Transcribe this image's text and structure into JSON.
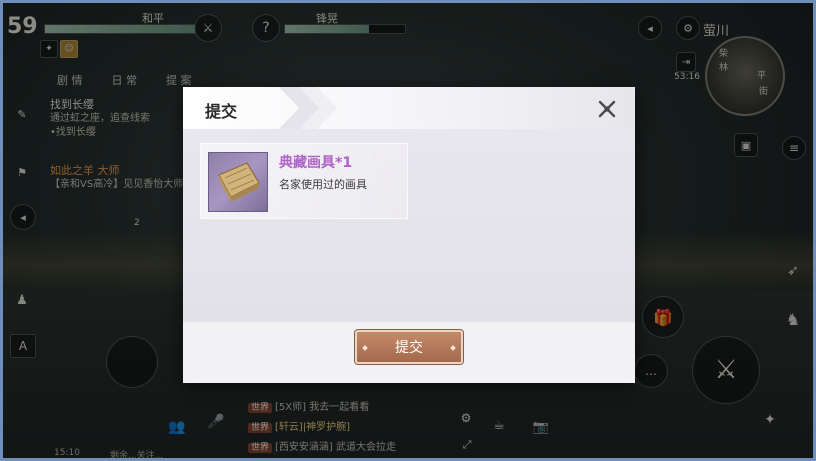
{
  "hud": {
    "level": "59",
    "team_left_name": "和平",
    "team_right_name": "锋晃",
    "right_player_name": "萤川",
    "clock": "53:16",
    "tabs": [
      "剧 情",
      "日 常",
      "提 案"
    ],
    "quest1_title": "找到长缨",
    "quest1_desc": "通过虹之座，追查线索",
    "quest1_sub": "•找到长缨",
    "quest2_title": "如此之羊 大师",
    "quest2_desc": "【亲和VS高冷】见见香怡大师",
    "quest_count": "2",
    "minimap_labels": [
      "柴",
      "林",
      "平",
      "街"
    ],
    "bottom_time": "15:10",
    "bottom_hint": "剩余...关注..."
  },
  "chat": [
    {
      "channel": "世界",
      "text": "[5X师] 我去一起看看",
      "tag": ""
    },
    {
      "channel": "世界",
      "text": "",
      "tag": "[轩云]|神罗护腕]"
    },
    {
      "channel": "世界",
      "text": "[西安安涵涵] 武道大会拉走",
      "tag": ""
    }
  ],
  "dialog": {
    "title": "提交",
    "item_name": "典藏画具*1",
    "item_desc": "名家使用过的画具",
    "submit_label": "提交"
  },
  "colors": {
    "item_name": "#b062c9",
    "submit_button": "#a26a4c",
    "frame_border": "#6f8fb8"
  },
  "icons": [
    "question-icon",
    "guild-icon",
    "map-exit-icon",
    "bag-icon",
    "menu-icon",
    "gift-icon",
    "horse-icon",
    "wing-icon",
    "sword-attack-icon",
    "chat-bubble-icon",
    "friends-icon",
    "voice-icon",
    "settings-icon",
    "teacup-icon",
    "camera-icon",
    "flag-icon",
    "scroll-icon",
    "person-icon",
    "text-a-icon",
    "close-icon",
    "painting-kit-icon"
  ]
}
